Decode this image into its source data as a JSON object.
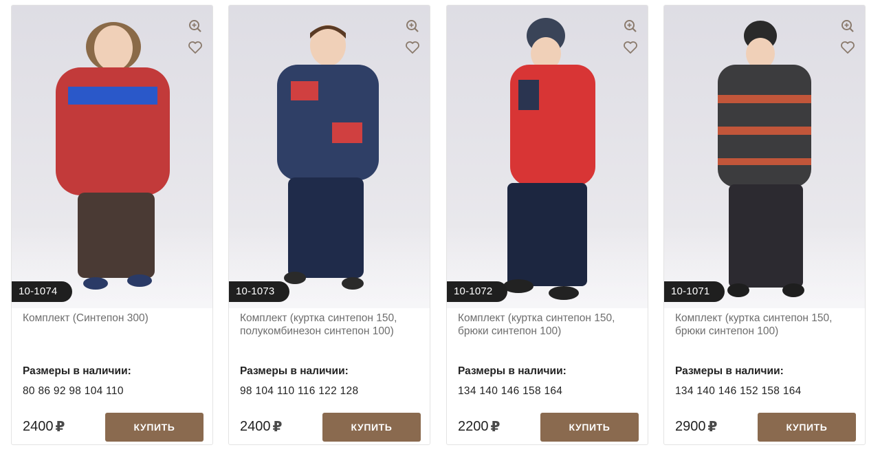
{
  "products": [
    {
      "sku": "10-1074",
      "title": "Комплект (Синтепон 300)",
      "sizes_label": "Размеры в наличии:",
      "sizes": "80 86 92 98 104 110",
      "price": "2400",
      "currency": "₽",
      "buy_label": "КУПИТЬ",
      "colors": {
        "jacket": "#c23a3a",
        "jacket_alt": "#2a58c9",
        "pants": "#4a3a34",
        "hat": "#7a5a3c"
      }
    },
    {
      "sku": "10-1073",
      "title": "Комплект (куртка синтепон 150, полукомбинезон синтепон 100)",
      "sizes_label": "Размеры в наличии:",
      "sizes": "98 104 110 116 122 128",
      "price": "2400",
      "currency": "₽",
      "buy_label": "КУПИТЬ",
      "colors": {
        "jacket": "#2f3f66",
        "jacket_alt": "#d04040",
        "pants": "#1f2b4a",
        "hat": "#5a3a24"
      }
    },
    {
      "sku": "10-1072",
      "title": "Комплект (куртка синтепон 150, брюки синтепон 100)",
      "sizes_label": "Размеры в наличии:",
      "sizes": "134 140 146 158 164",
      "price": "2200",
      "currency": "₽",
      "buy_label": "КУПИТЬ",
      "colors": {
        "jacket": "#d83535",
        "jacket_alt": "#2a3450",
        "pants": "#1c2640",
        "hat": "#3a4458"
      }
    },
    {
      "sku": "10-1071",
      "title": "Комплект (куртка синтепон 150, брюки синтепон 100)",
      "sizes_label": "Размеры в наличии:",
      "sizes": "134 140 146 152 158 164",
      "price": "2900",
      "currency": "₽",
      "buy_label": "КУПИТЬ",
      "colors": {
        "jacket": "#3c3c3e",
        "jacket_alt": "#c2563a",
        "pants": "#2c2a30",
        "hat": "#2a2a2a"
      }
    }
  ],
  "icons": {
    "zoom": "zoom-in-icon",
    "favorite": "heart-icon"
  },
  "theme": {
    "accent": "#8a6a4f",
    "badge": "#1f1f1f",
    "icon": "#8a7a6c"
  }
}
